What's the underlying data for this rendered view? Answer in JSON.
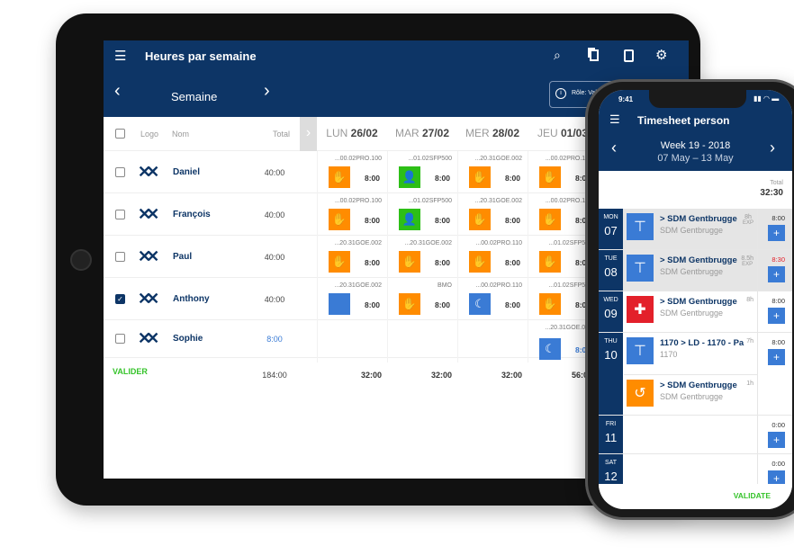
{
  "tablet": {
    "title": "Heures par semaine",
    "week_label": "Semaine",
    "role_label": "Rôle: Val",
    "colors": {
      "navy": "#0d3566",
      "orange": "#ff8c00",
      "green": "#2dbf16",
      "blue": "#3a7bd5",
      "valider": "#35c32a"
    },
    "headers": {
      "logo": "Logo",
      "name": "Nom",
      "total": "Total"
    },
    "days": [
      {
        "d": "LUN",
        "n": "26/02"
      },
      {
        "d": "MAR",
        "n": "27/02"
      },
      {
        "d": "MER",
        "n": "28/02"
      },
      {
        "d": "JEU",
        "n": "01/03"
      }
    ],
    "rows": [
      {
        "name": "Daniel",
        "total": "40:00",
        "checked": false,
        "cells": [
          {
            "code": "...00.02PRO.100",
            "icon": "handshake",
            "h": "8:00"
          },
          {
            "code": "...01.02SFP500",
            "icon": "person",
            "h": "8:00"
          },
          {
            "code": "...20.31GOE.002",
            "icon": "handshake",
            "h": "8:00"
          },
          {
            "code": "...00.02PRO.100",
            "icon": "handshake",
            "h": "8:00"
          }
        ]
      },
      {
        "name": "François",
        "total": "40:00",
        "checked": false,
        "cells": [
          {
            "code": "...00.02PRO.100",
            "icon": "handshake",
            "h": "8:00"
          },
          {
            "code": "...01.02SFP500",
            "icon": "person",
            "h": "8:00"
          },
          {
            "code": "...20.31GOE.002",
            "icon": "handshake",
            "h": "8:00"
          },
          {
            "code": "...00.02PRO.100",
            "icon": "handshake",
            "h": "8:00"
          }
        ]
      },
      {
        "name": "Paul",
        "total": "40:00",
        "checked": false,
        "cells": [
          {
            "code": "...20.31GOE.002",
            "icon": "handshake",
            "h": "8:00"
          },
          {
            "code": "...20.31GOE.002",
            "icon": "handshake",
            "h": "8:00"
          },
          {
            "code": "...00.02PRO.110",
            "icon": "handshake",
            "h": "8:00"
          },
          {
            "code": "...01.02SFP500",
            "icon": "handshake",
            "h": "8:00"
          }
        ]
      },
      {
        "name": "Anthony",
        "total": "40:00",
        "checked": true,
        "cells": [
          {
            "code": "...20.31GOE.002",
            "icon": "stack",
            "h": "8:00"
          },
          {
            "code": "BMO",
            "icon": "handshake",
            "h": "8:00"
          },
          {
            "code": "...00.02PRO.110",
            "icon": "moon",
            "h": "8:00"
          },
          {
            "code": "...01.02SFP500",
            "icon": "handshake",
            "h": "8:00"
          }
        ]
      },
      {
        "name": "Sophie",
        "total": "8:00",
        "checked": false,
        "cells": [
          null,
          null,
          null,
          {
            "code": "...20.31GOE.001",
            "icon": "moon",
            "h": "8:00"
          }
        ]
      }
    ],
    "valider": "VALIDER",
    "footer_totals": [
      "184:00",
      "32:00",
      "32:00",
      "32:00",
      "56:00"
    ]
  },
  "phone": {
    "time": "9:41",
    "title": "Timesheet person",
    "week": "Week 19 - 2018",
    "range": "07 May – 13 May",
    "total_label": "Total",
    "total": "32:30",
    "days": [
      {
        "d": "MON",
        "n": "07",
        "time": "8:00",
        "red": false,
        "grey": true,
        "entries": [
          {
            "icon": "crane",
            "title": "> SDM Gentbrugge",
            "sub": "SDM Gentbrugge",
            "h": "8h",
            "exp": "EXP"
          }
        ]
      },
      {
        "d": "TUE",
        "n": "08",
        "time": "8:30",
        "red": true,
        "grey": true,
        "entries": [
          {
            "icon": "crane",
            "title": "> SDM Gentbrugge",
            "sub": "SDM Gentbrugge",
            "h": "8.5h",
            "exp": "EXP"
          }
        ]
      },
      {
        "d": "WED",
        "n": "09",
        "time": "8:00",
        "red": false,
        "grey": false,
        "entries": [
          {
            "icon": "cross",
            "title": "> SDM Gentbrugge",
            "sub": "SDM Gentbrugge",
            "h": "8h"
          }
        ]
      },
      {
        "d": "THU",
        "n": "10",
        "time": "8:00",
        "red": false,
        "grey": false,
        "entries": [
          {
            "icon": "crane",
            "title": "1170 > LD - 1170 - Pa",
            "sub": "1170",
            "h": "7h"
          },
          {
            "icon": "history",
            "title": "> SDM Gentbrugge",
            "sub": "SDM Gentbrugge",
            "h": "1h"
          }
        ]
      },
      {
        "d": "FRI",
        "n": "11",
        "time": "0:00",
        "red": false,
        "grey": false,
        "entries": []
      },
      {
        "d": "SAT",
        "n": "12",
        "time": "0:00",
        "red": false,
        "grey": false,
        "entries": []
      }
    ],
    "validate": "VALIDATE"
  }
}
